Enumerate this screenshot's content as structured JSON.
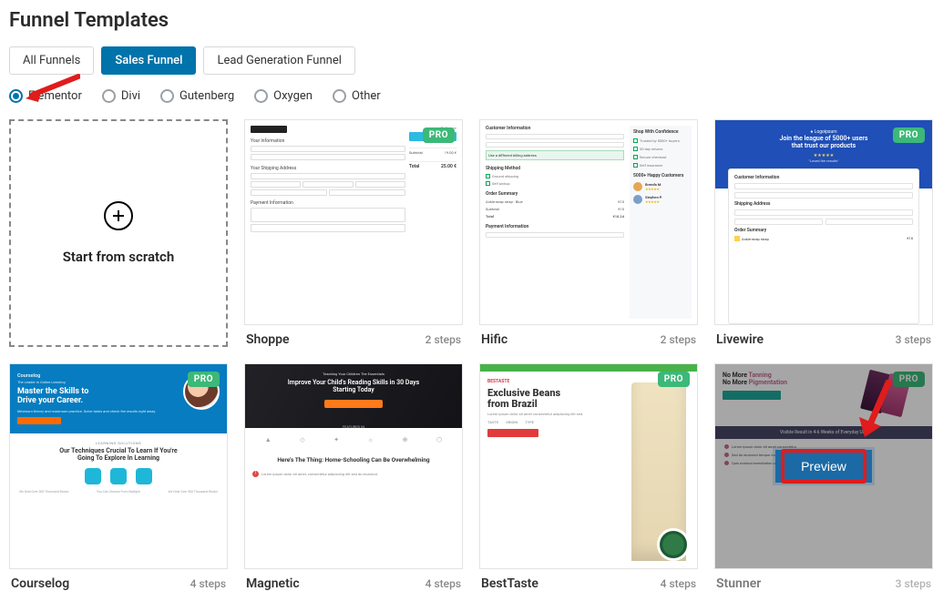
{
  "page_title": "Funnel Templates",
  "tabs": [
    {
      "label": "All Funnels",
      "active": false
    },
    {
      "label": "Sales Funnel",
      "active": true
    },
    {
      "label": "Lead Generation Funnel",
      "active": false
    }
  ],
  "builders": [
    {
      "label": "Elementor",
      "checked": true
    },
    {
      "label": "Divi",
      "checked": false
    },
    {
      "label": "Gutenberg",
      "checked": false
    },
    {
      "label": "Oxygen",
      "checked": false
    },
    {
      "label": "Other",
      "checked": false
    }
  ],
  "scratch_label": "Start from scratch",
  "preview_button": "Preview",
  "pro_label": "PRO",
  "templates": [
    {
      "name": "Shoppe",
      "steps": "2 steps",
      "pro": true,
      "hovered": false
    },
    {
      "name": "Hific",
      "steps": "2 steps",
      "pro": false,
      "hovered": false
    },
    {
      "name": "Livewire",
      "steps": "3 steps",
      "pro": true,
      "hovered": false
    },
    {
      "name": "Courselog",
      "steps": "4 steps",
      "pro": true,
      "hovered": false
    },
    {
      "name": "Magnetic",
      "steps": "4 steps",
      "pro": false,
      "hovered": false
    },
    {
      "name": "BestTaste",
      "steps": "4 steps",
      "pro": true,
      "hovered": false
    },
    {
      "name": "Stunner",
      "steps": "3 steps",
      "pro": true,
      "hovered": true
    }
  ]
}
